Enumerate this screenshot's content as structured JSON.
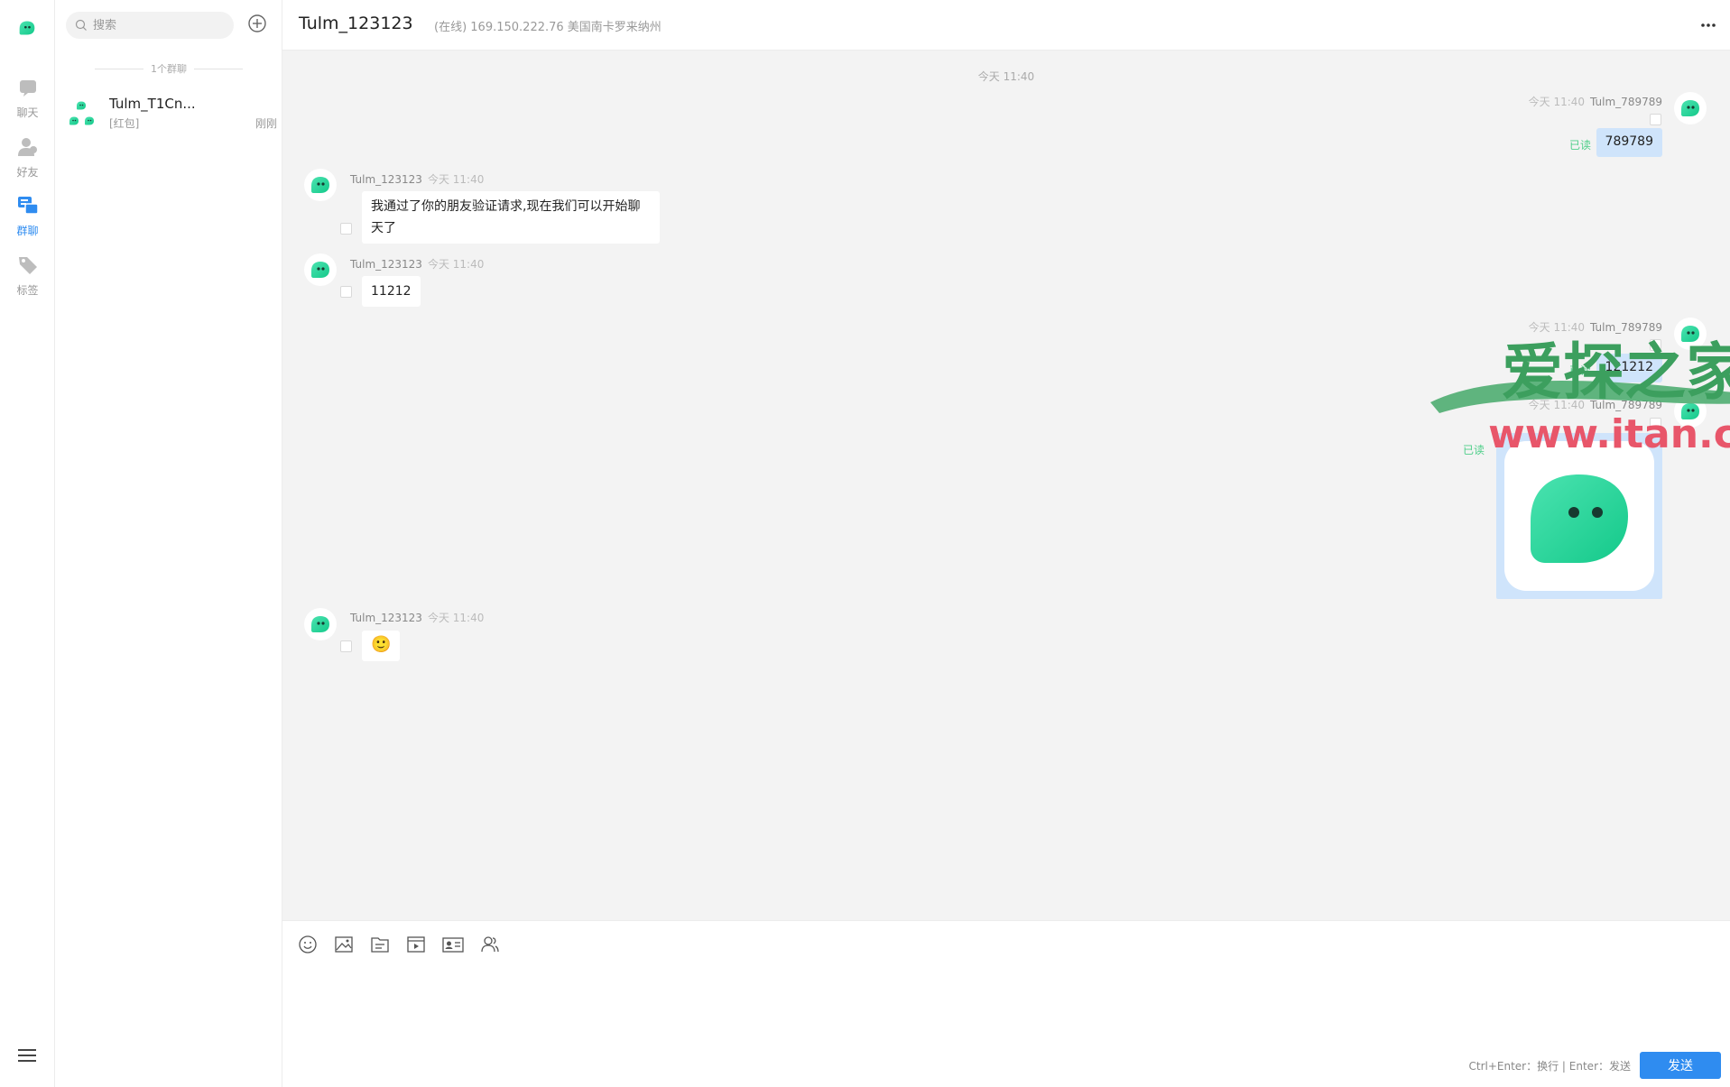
{
  "sidebar": {
    "items": [
      {
        "label": "聊天",
        "icon": "chat-icon"
      },
      {
        "label": "好友",
        "icon": "friends-icon"
      },
      {
        "label": "群聊",
        "icon": "group-chat-icon",
        "active": true
      },
      {
        "label": "标签",
        "icon": "tag-icon"
      }
    ]
  },
  "conversations": {
    "search_placeholder": "搜索",
    "group_count_label": "1个群聊",
    "items": [
      {
        "name": "Tulm_T1Cn...",
        "preview": "[红包]",
        "time": "刚刚"
      }
    ]
  },
  "chat": {
    "title": "Tulm_123123",
    "status": "(在线) 169.150.222.76 美国南卡罗来纳州",
    "time_divider": "今天 11:40",
    "messages": [
      {
        "side": "right",
        "sender": "Tulm_789789",
        "time": "今天 11:40",
        "text": "789789",
        "read": "已读"
      },
      {
        "side": "left",
        "sender": "Tulm_123123",
        "time": "今天 11:40",
        "text_line1": "我通过了你的朋友验证请求,现在我们可以开始聊",
        "text_line2": "天了"
      },
      {
        "side": "left",
        "sender": "Tulm_123123",
        "time": "今天 11:40",
        "text": "11212"
      },
      {
        "side": "right",
        "sender": "Tulm_789789",
        "time": "今天 11:40",
        "text": "121212",
        "read": "已读"
      },
      {
        "side": "right",
        "sender": "Tulm_789789",
        "time": "今天 11:40",
        "type": "image",
        "read": "已读"
      },
      {
        "side": "left",
        "sender": "Tulm_123123",
        "time": "今天 11:40",
        "text": "🙂"
      }
    ]
  },
  "watermark": {
    "line1": "爱探之家",
    "line2": "www.itan.cc"
  },
  "composer": {
    "hint": "Ctrl+Enter：换行 | Enter：发送",
    "send_label": "发送"
  },
  "colors": {
    "brand_green": "#2fd59a",
    "accent_blue": "#2f8cf0",
    "read_green": "#4fcf8a",
    "bubble_mine": "#cfe4fb"
  }
}
